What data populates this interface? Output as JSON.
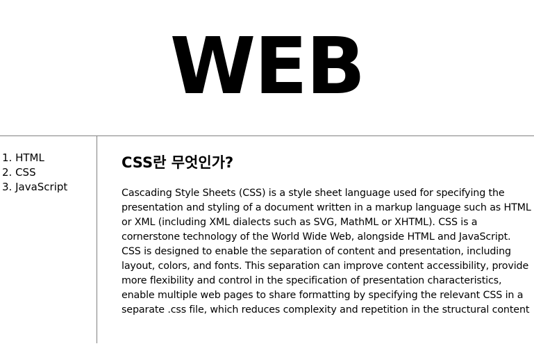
{
  "header": {
    "title": "WEB"
  },
  "nav": {
    "items": [
      {
        "label": "1. HTML"
      },
      {
        "label": "2. CSS"
      },
      {
        "label": "3. JavaScript"
      }
    ]
  },
  "article": {
    "title": "CSS란 무엇인가?",
    "body": "Cascading Style Sheets (CSS) is a style sheet language used for specifying the presentation and styling of a document written in a markup language such as HTML or XML (including XML dialects such as SVG, MathML or XHTML). CSS is a cornerstone technology of the World Wide Web, alongside HTML and JavaScript. CSS is designed to enable the separation of content and presentation, including layout, colors, and fonts. This separation can improve content accessibility, provide more flexibility and control in the specification of presentation characteristics, enable multiple web pages to share formatting by specifying the relevant CSS in a separate .css file, which reduces complexity and repetition in the structural content"
  },
  "colors": {
    "text": "#000000",
    "background": "#ffffff",
    "divider": "#808080"
  }
}
